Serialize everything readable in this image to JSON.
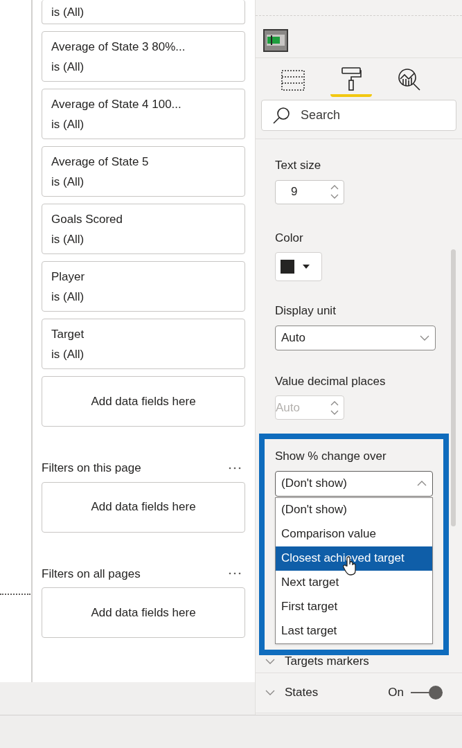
{
  "filters_on_this_visual": [
    {
      "subtitle": "is (All)"
    },
    {
      "title": "Average of State 3 80%...",
      "subtitle": "is (All)"
    },
    {
      "title": "Average of State 4 100...",
      "subtitle": "is (All)"
    },
    {
      "title": "Average of State 5",
      "subtitle": "is (All)"
    },
    {
      "title": "Goals Scored",
      "subtitle": "is (All)"
    },
    {
      "title": "Player",
      "subtitle": "is (All)"
    },
    {
      "title": "Target",
      "subtitle": "is (All)"
    }
  ],
  "visual_drop_zone": "Add data fields here",
  "filter_sections": [
    {
      "title": "Filters on this page",
      "drop_zone": "Add data fields here"
    },
    {
      "title": "Filters on all pages",
      "drop_zone": "Add data fields here"
    }
  ],
  "pane_tabs": [
    {
      "kind": "fields",
      "selected": false
    },
    {
      "kind": "format",
      "selected": true
    },
    {
      "kind": "analytics",
      "selected": false
    }
  ],
  "search": {
    "placeholder": "Search"
  },
  "text_size": {
    "label": "Text size",
    "value": "9",
    "disabled": false
  },
  "color": {
    "label": "Color",
    "color": "#252423"
  },
  "display_unit": {
    "label": "Display unit",
    "value": "Auto"
  },
  "decimal_places": {
    "label": "Value decimal places",
    "value": "Auto",
    "disabled": true
  },
  "percent_change": {
    "label": "Show % change over",
    "value": "(Don't show)",
    "expanded": true,
    "options": [
      {
        "label": "(Don't show)",
        "highlighted": false
      },
      {
        "label": "Comparison value",
        "highlighted": false
      },
      {
        "label": "Closest achieved target",
        "highlighted": true
      },
      {
        "label": "Next target",
        "highlighted": false
      },
      {
        "label": "First target",
        "highlighted": false
      },
      {
        "label": "Last target",
        "highlighted": false
      }
    ]
  },
  "sections": [
    {
      "title": "Targets markers"
    },
    {
      "title": "States",
      "toggle": {
        "label": "On",
        "on": true
      }
    }
  ]
}
